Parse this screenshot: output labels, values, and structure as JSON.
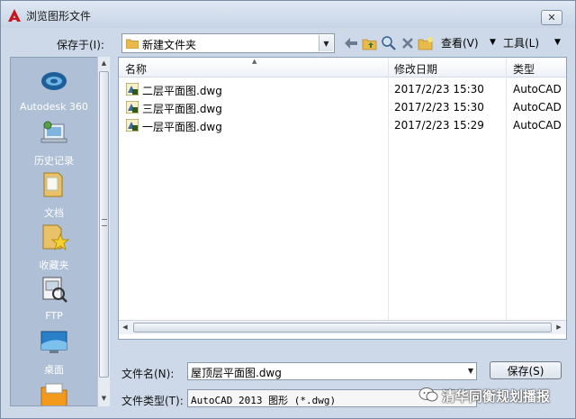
{
  "window": {
    "title": "浏览图形文件",
    "close_label": "✕"
  },
  "toolbar": {
    "save_in_label": "保存于(I):",
    "save_in_value": "新建文件夹",
    "view_label": "查看(V)",
    "tools_label": "工具(L)",
    "icons": [
      "back-arrow-icon",
      "up-folder-icon",
      "search-web-icon",
      "delete-icon",
      "new-folder-icon"
    ]
  },
  "places": [
    {
      "label": "Autodesk 360",
      "icon": "autodesk-360-icon"
    },
    {
      "label": "历史记录",
      "icon": "history-icon"
    },
    {
      "label": "文档",
      "icon": "documents-icon"
    },
    {
      "label": "收藏夹",
      "icon": "favorites-icon"
    },
    {
      "label": "FTP",
      "icon": "ftp-icon"
    },
    {
      "label": "桌面",
      "icon": "desktop-icon"
    }
  ],
  "filelist": {
    "columns": [
      "名称",
      "修改日期",
      "类型"
    ],
    "rows": [
      {
        "name": "二层平面图.dwg",
        "date": "2017/2/23 15:30",
        "type": "AutoCAD"
      },
      {
        "name": "三层平面图.dwg",
        "date": "2017/2/23 15:30",
        "type": "AutoCAD"
      },
      {
        "name": "一层平面图.dwg",
        "date": "2017/2/23 15:29",
        "type": "AutoCAD"
      }
    ]
  },
  "footer": {
    "filename_label": "文件名(N):",
    "filename_value": "屋顶层平面图.dwg",
    "filetype_label": "文件类型(T):",
    "filetype_value": "AutoCAD 2013 图形 (*.dwg)",
    "save_button": "保存(S)"
  },
  "watermark": {
    "text": "清华同衡规划播报"
  },
  "colors": {
    "accent": "#cdd9e8",
    "places_bg": "#aebfd6",
    "title_icon": "#c8161d"
  }
}
